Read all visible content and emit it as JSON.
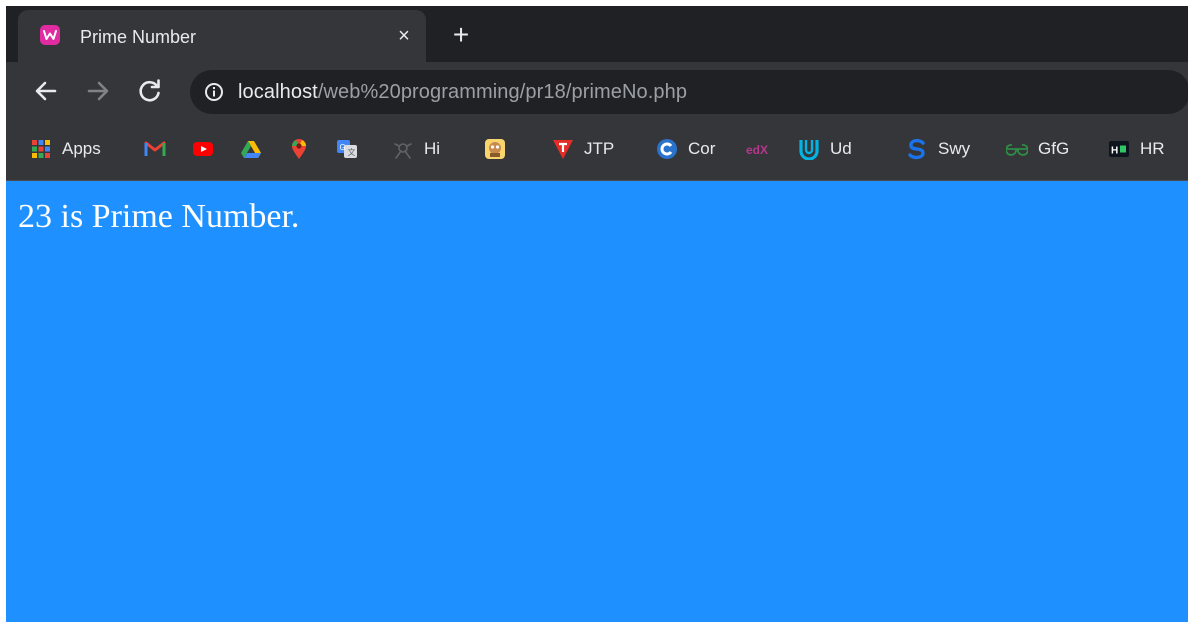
{
  "browser": {
    "tab": {
      "title": "Prime Number",
      "close_label": "×"
    },
    "new_tab_label": "+",
    "address": {
      "host": "localhost",
      "path": "/web%20programming/pr18/primeNo.php"
    }
  },
  "bookmarks": [
    {
      "label": "Apps",
      "icon": "apps-grid-icon"
    },
    {
      "label": "",
      "icon": "gmail-icon"
    },
    {
      "label": "",
      "icon": "youtube-icon"
    },
    {
      "label": "",
      "icon": "google-drive-icon"
    },
    {
      "label": "",
      "icon": "google-maps-icon"
    },
    {
      "label": "",
      "icon": "google-translate-icon"
    },
    {
      "label": "Hi",
      "icon": "hi-bookmark-icon"
    },
    {
      "label": "",
      "icon": "avatar-bookmark-icon"
    },
    {
      "label": "JTP",
      "icon": "jtp-icon"
    },
    {
      "label": "Cor",
      "icon": "coursera-icon"
    },
    {
      "label": "",
      "icon": "edx-icon"
    },
    {
      "label": "Ud",
      "icon": "udacity-icon"
    },
    {
      "label": "Swy",
      "icon": "swayam-icon"
    },
    {
      "label": "GfG",
      "icon": "gfg-icon"
    },
    {
      "label": "HR",
      "icon": "hackerrank-icon"
    }
  ],
  "page": {
    "message": "23 is Prime Number.",
    "background": "#1e90ff"
  },
  "colors": {
    "favicon": "#e12ba1",
    "toolbar": "#35363a",
    "tabstrip": "#202124"
  }
}
